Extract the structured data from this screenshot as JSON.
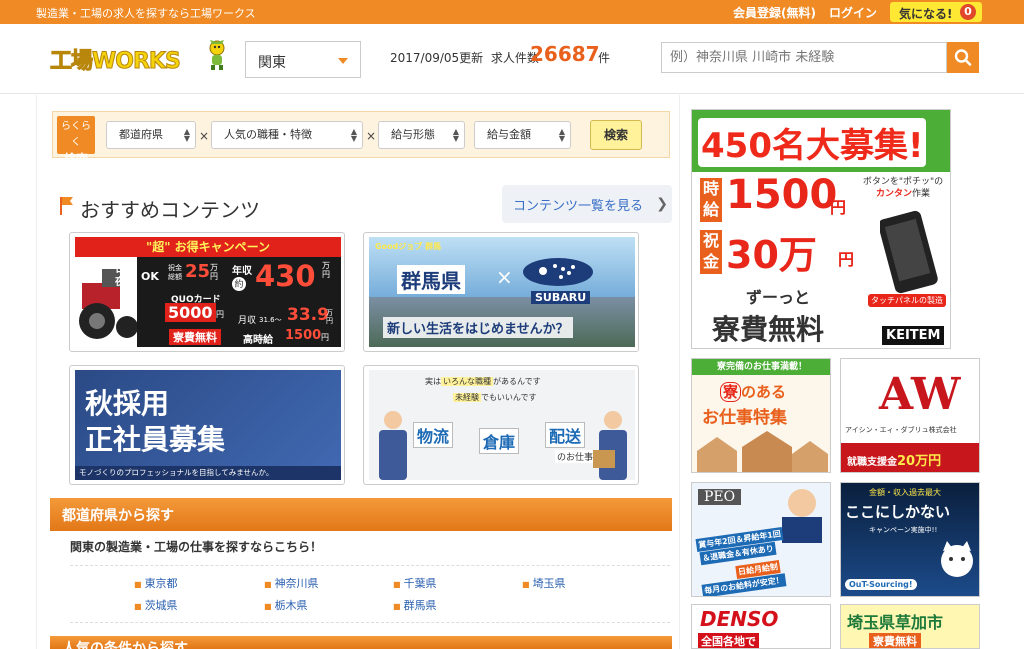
{
  "topbar": {
    "tagline": "製造業・工場の求人を探すなら工場ワークス",
    "register": "会員登録(無料)",
    "login": "ログイン",
    "favorites": "気になる!",
    "favorites_count": "0"
  },
  "header": {
    "logo": "工場WORKS",
    "region": "関東",
    "updated": "2017/09/05更新",
    "job_label": "求人件数",
    "job_count": "26687",
    "job_unit": "件",
    "search_placeholder": "例）神奈川県 川崎市 未経験"
  },
  "quick_search": {
    "label_line1": "らくらく",
    "label_line2": "検索",
    "selects": [
      "都道府県",
      "人気の職種・特徴",
      "給与形態",
      "給与金額"
    ],
    "times": "×",
    "button": "検索"
  },
  "recommended": {
    "title": "おすすめコンテンツ",
    "link": "コンテンツ一覧を見る",
    "card1": {
      "headline": "\"超\" お得キャンペーン",
      "shift": "日勤夜勤",
      "ok": "OK",
      "bonus_label": "祝金総額",
      "bonus": "25",
      "bonus_unit": "万円",
      "income_label": "年収",
      "income_approx": "約",
      "income": "430",
      "income_unit": "万円",
      "quo_label": "QUOカード",
      "quo": "5000",
      "quo_unit": "円",
      "monthly_label": "月収",
      "monthly_range": "31.6〜",
      "monthly": "33.9",
      "monthly_unit": "万円",
      "dorm": "寮費無料",
      "hourly_label": "高時給",
      "hourly": "1500",
      "hourly_unit": "円"
    },
    "card2": {
      "tag": "Goodジョブ 群馬",
      "pref": "群馬県",
      "brand": "SUBARU",
      "tagline": "新しい生活をはじめませんか？"
    },
    "card3": {
      "line1": "秋採用",
      "line2": "正社員募集",
      "caption": "モノづくりのプロフェッショナルを目指してみませんか。"
    },
    "card4": {
      "bubble_pre": "実は",
      "bubble_mark": "いろんな職種",
      "bubble_post": "があるんです",
      "bubble2_mark": "未経験",
      "bubble2_post": "でもいいんです",
      "w1": "物流",
      "w2": "倉庫",
      "w3": "配送",
      "w4": "のお仕事"
    }
  },
  "prefecture_section": {
    "title": "都道府県から探す",
    "description": "関東の製造業・工場の仕事を探すならこちら！",
    "bullet": "■",
    "prefectures": [
      "東京都",
      "神奈川県",
      "千葉県",
      "埼玉県",
      "茨城県",
      "栃木県",
      "群馬県"
    ]
  },
  "popular_section": {
    "title": "人気の条件から探す"
  },
  "ads": {
    "big": {
      "headline": "450名大募集!",
      "hourly_label_1": "時",
      "hourly_label_2": "給",
      "hourly": "1500",
      "hourly_unit": "円",
      "bonus_label_1": "祝",
      "bonus_label_2": "金",
      "bonus": "30万",
      "bonus_unit": "円",
      "bubble": "ボタンを\"ポチッ\"の",
      "bubble_mark": "カンタン",
      "bubble_post": "作業",
      "panel": "タッチパネルの製造",
      "dorm_pre": "ずーっと",
      "dorm": "寮費無料",
      "company": "KEITEM"
    },
    "dorm": {
      "head": "寮完備のお仕事満載！",
      "line1_mark": "寮",
      "line1": "のある",
      "line2": "お仕事特集"
    },
    "aw": {
      "logo": "AW",
      "company": "アイシン・エィ・ダブリュ株式会社",
      "bonus_label": "就職支援金",
      "bonus": "20万円"
    },
    "peo": {
      "logo": "PEO",
      "text1": "賞与年2回＆昇給年1回",
      "text2": "＆退職金＆有休あり",
      "text3": "日給月給制",
      "text4": "毎月のお給料が安定！"
    },
    "outsourcing": {
      "top": "金額・収入過去最大",
      "headline": "ここにしかない",
      "sub": "キャンペーン実施中!!",
      "company": "OuT-Sourcing!"
    },
    "denso": {
      "logo": "DENSO",
      "sub": "全国各地で"
    },
    "soka": {
      "headline": "埼玉県草加市",
      "sub": "寮費無料"
    }
  }
}
